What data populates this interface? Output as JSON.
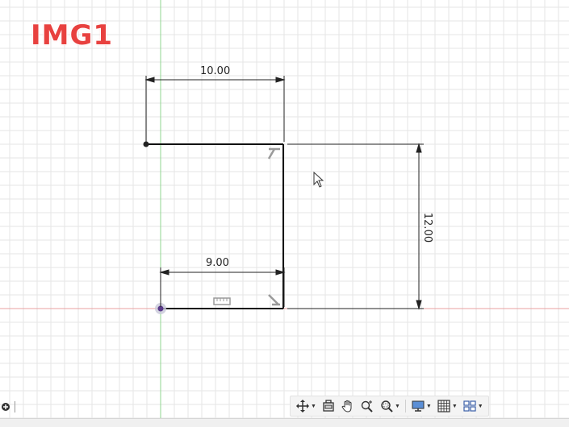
{
  "overlay_label": "IMG1",
  "dimensions": {
    "top_width": "10.00",
    "bottom_width": "9.00",
    "right_height": "12.00"
  },
  "toolbar": {
    "items": [
      {
        "icon": "orbit-icon",
        "has_dropdown": true
      },
      {
        "icon": "look-at-icon",
        "has_dropdown": false
      },
      {
        "icon": "pan-hand-icon",
        "has_dropdown": false
      },
      {
        "icon": "zoom-icon",
        "has_dropdown": false
      },
      {
        "icon": "zoom-window-icon",
        "has_dropdown": true
      },
      {
        "icon": "display-settings-icon",
        "has_dropdown": true
      },
      {
        "icon": "grid-settings-icon",
        "has_dropdown": true
      },
      {
        "icon": "viewports-icon",
        "has_dropdown": true
      }
    ]
  },
  "colors": {
    "grid": "#e6e6e6",
    "x_axis": "#e8a0a0",
    "y_axis": "#8fd68f",
    "sketch_line": "#111111",
    "label": "#e8413f"
  }
}
